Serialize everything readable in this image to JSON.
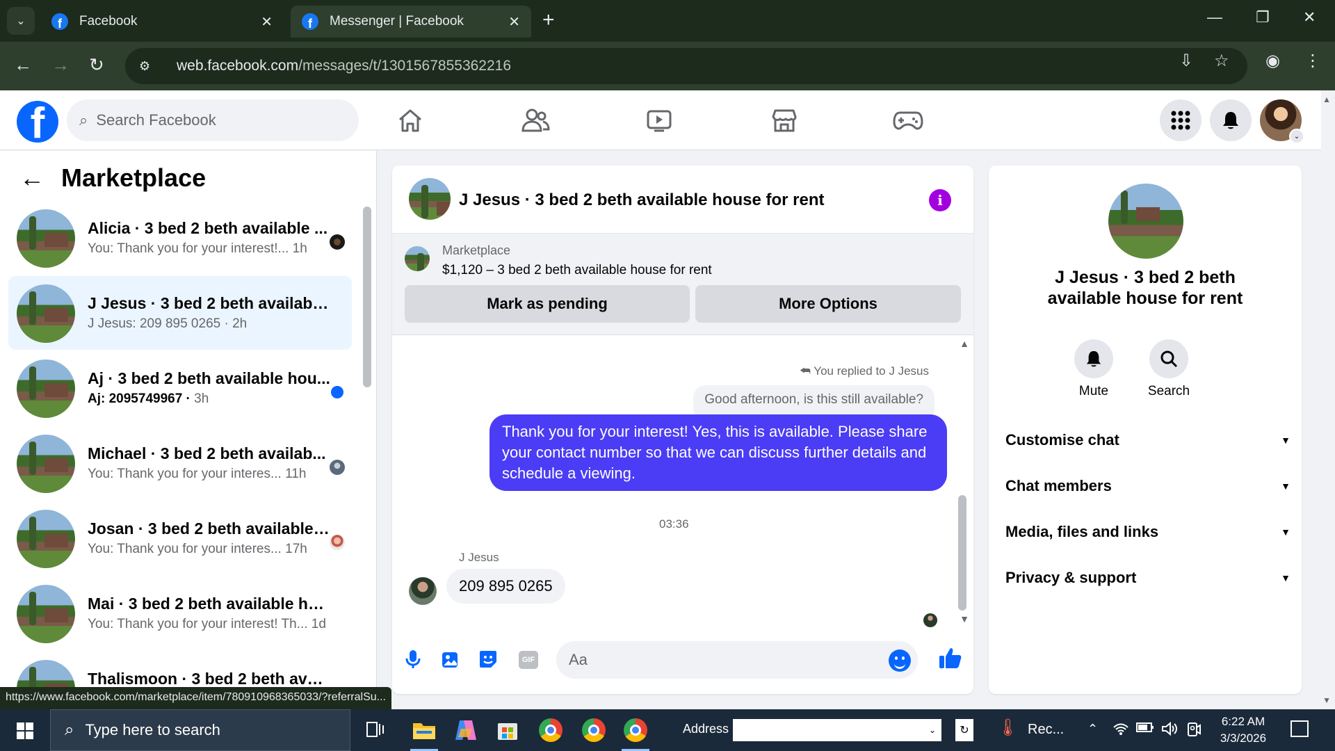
{
  "browser": {
    "tabs": [
      {
        "title": "Facebook",
        "active": false
      },
      {
        "title": "Messenger | Facebook",
        "active": true
      }
    ],
    "url_host": "web.facebook.com",
    "url_path": "/messages/t/1301567855362216",
    "status_url": "https://www.facebook.com/marketplace/item/780910968365033/?referralSu..."
  },
  "header": {
    "search_placeholder": "Search Facebook",
    "nav_icons": [
      "home-icon",
      "friends-icon",
      "video-icon",
      "marketplace-icon",
      "gaming-icon"
    ]
  },
  "sidebar": {
    "title": "Marketplace",
    "chats": [
      {
        "name": "Alicia · 3 bed 2 beth available ...",
        "preview": "You: Thank you for your interest!...",
        "time": "1h",
        "selected": false,
        "unread": false
      },
      {
        "name": "J Jesus · 3 bed 2 beth available h...",
        "preview": "J Jesus: 209 895 0265",
        "time": "2h",
        "selected": true,
        "unread": false
      },
      {
        "name": "Aj · 3 bed 2 beth available hou...",
        "preview": "Aj: 2095749967",
        "time": "3h",
        "selected": false,
        "unread": true
      },
      {
        "name": "Michael · 3 bed 2 beth availab...",
        "preview": "You: Thank you for your interes...",
        "time": "11h",
        "selected": false,
        "unread": false
      },
      {
        "name": "Josan · 3 bed 2 beth available ...",
        "preview": "You: Thank you for your interes...",
        "time": "17h",
        "selected": false,
        "unread": false
      },
      {
        "name": "Mai · 3 bed 2 beth available hou...",
        "preview": "You: Thank you for your interest! Th...",
        "time": "1d",
        "selected": false,
        "unread": false
      },
      {
        "name": "Thalismoon · 3 bed 2 beth availa...",
        "preview": "",
        "time": "",
        "selected": false,
        "unread": false
      }
    ]
  },
  "conversation": {
    "title": "J Jesus · 3 bed 2 beth available house for rent",
    "listing_source": "Marketplace",
    "listing_title": "$1,120 – 3 bed 2 beth available house for rent",
    "mark_pending_label": "Mark as pending",
    "more_options_label": "More Options",
    "replied_note": "You replied to J Jesus",
    "quoted_message": "Good afternoon, is this still available?",
    "my_message": "Thank you for your interest! Yes, this is available. Please share your contact number so that we can discuss further details and schedule a viewing.",
    "timestamp": "03:36",
    "sender_name": "J Jesus",
    "their_message": "209 895 0265",
    "input_placeholder": "Aa",
    "gif_label": "GIF"
  },
  "details": {
    "name": "J Jesus · 3 bed 2 beth available house for rent",
    "actions": [
      {
        "label": "Mute",
        "icon": "bell-icon"
      },
      {
        "label": "Search",
        "icon": "search-icon"
      }
    ],
    "sections": [
      "Customise chat",
      "Chat members",
      "Media, files and links",
      "Privacy & support"
    ]
  },
  "taskbar": {
    "search_placeholder": "Type here to search",
    "address_label": "Address",
    "weather_label": "Rec...",
    "time": "6:22 AM",
    "date": "3/3/2026"
  },
  "colors": {
    "brand": "#0866ff",
    "my_bubble": "#4b3cf5",
    "info": "#a300e0"
  }
}
